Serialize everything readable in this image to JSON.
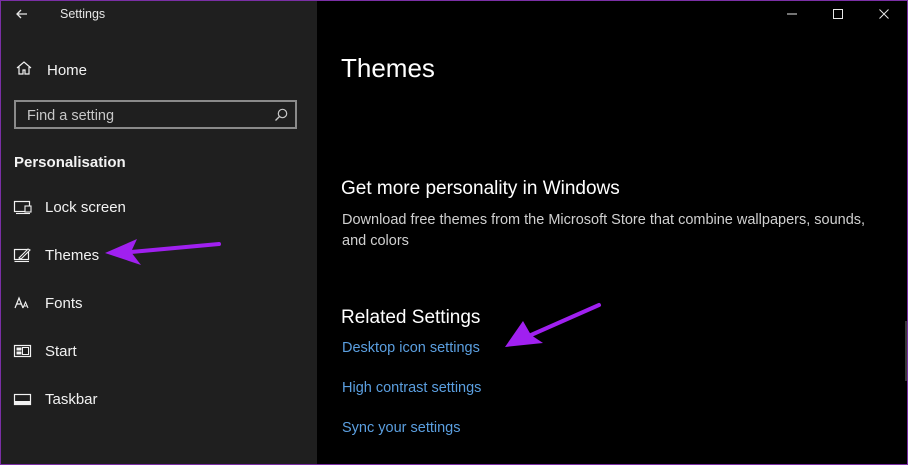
{
  "window": {
    "title": "Settings",
    "border_color": "#7a2fa5",
    "controls": [
      "minimize-icon",
      "maximize-icon",
      "close-icon"
    ]
  },
  "sidebar": {
    "home_label": "Home",
    "search": {
      "placeholder": "Find a setting",
      "value": ""
    },
    "section_title": "Personalisation",
    "items": [
      {
        "label": "Lock screen",
        "icon": "lock-screen-icon"
      },
      {
        "label": "Themes",
        "icon": "themes-icon"
      },
      {
        "label": "Fonts",
        "icon": "fonts-icon"
      },
      {
        "label": "Start",
        "icon": "start-icon"
      },
      {
        "label": "Taskbar",
        "icon": "taskbar-icon"
      }
    ],
    "background": "#1f1f1f"
  },
  "main": {
    "title": "Themes",
    "promo": {
      "heading": "Get more personality in Windows",
      "description": "Download free themes from the Microsoft Store that combine wallpapers, sounds, and colors"
    },
    "related": {
      "heading": "Related Settings",
      "links": [
        "Desktop icon settings",
        "High contrast settings",
        "Sync your settings"
      ]
    },
    "link_color": "#5b9fe0",
    "annotation_color": "#a020f0"
  }
}
